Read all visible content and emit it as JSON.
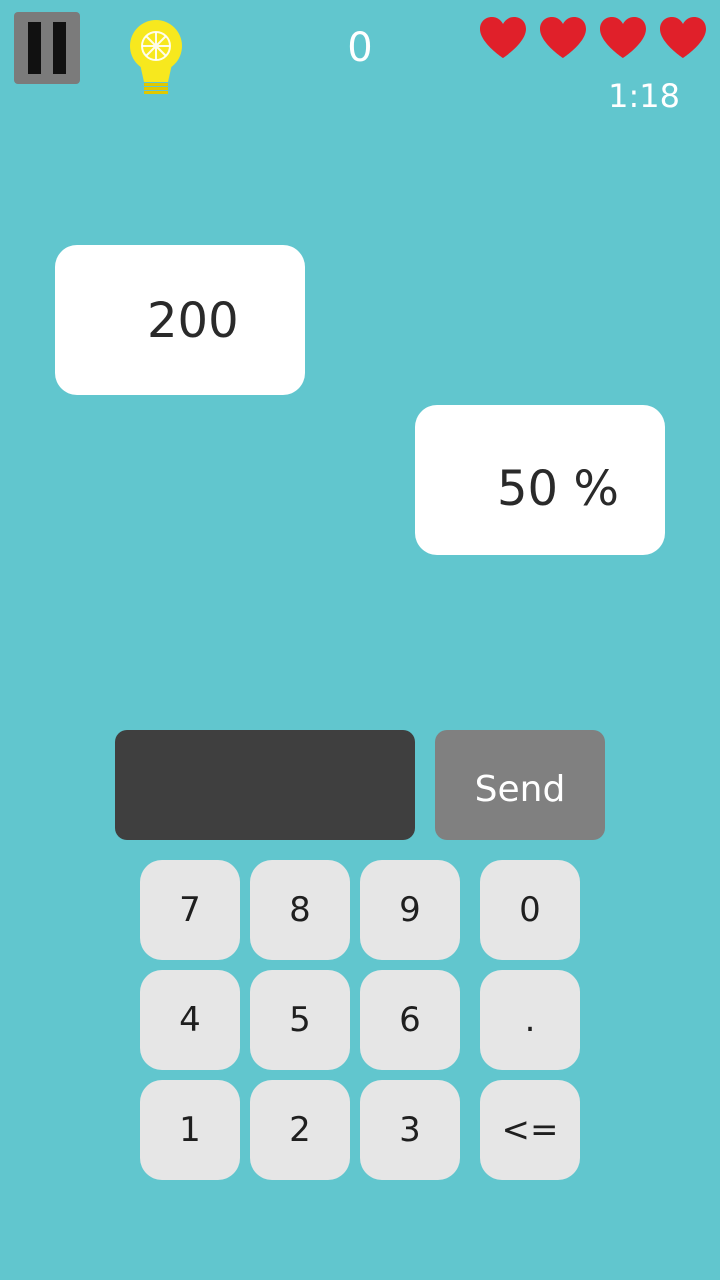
{
  "hud": {
    "score": "0",
    "timer": "1:18",
    "lives": 4,
    "colors": {
      "heart": "#e0202a",
      "bulb": "#f7e81e",
      "pause_bg": "#7b7b7b"
    }
  },
  "problem": {
    "base_value": "200",
    "percent_value": "50 %"
  },
  "answer": {
    "value": "",
    "send_label": "Send"
  },
  "keypad": {
    "k7": "7",
    "k8": "8",
    "k9": "9",
    "k0": "0",
    "k4": "4",
    "k5": "5",
    "k6": "6",
    "kdot": ".",
    "k1": "1",
    "k2": "2",
    "k3": "3",
    "kback": "<="
  },
  "theme": {
    "background": "#61c6ce",
    "input_bg": "#3f3f3f",
    "send_bg": "#808080",
    "key_bg": "#e6e6e6"
  }
}
